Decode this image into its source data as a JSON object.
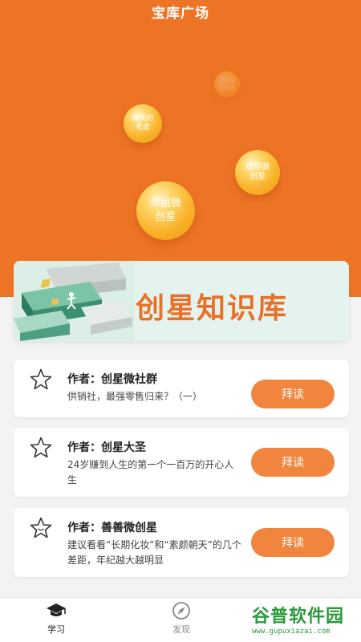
{
  "header": {
    "title": "宝库广场"
  },
  "bubbles": [
    {
      "label": "骞剑花纹创业"
    },
    {
      "label": "微笑的老虎"
    },
    {
      "label": "尋导微创星"
    },
    {
      "label": "华姐微创星"
    }
  ],
  "banner": {
    "title": "创星知识库"
  },
  "articles": [
    {
      "author": "作者：创星微社群",
      "desc": "供销社，最强零售归来？（一）",
      "button": "拜读"
    },
    {
      "author": "作者：创星大圣",
      "desc": "24岁赚到人生的第一个一百万的开心人生",
      "button": "拜读"
    },
    {
      "author": "作者：善善微创星",
      "desc": "建议看看“长期化妆”和“素颜朝天”的几个差距，年纪越大越明显",
      "button": "拜读"
    }
  ],
  "tabs": [
    {
      "label": "学习"
    },
    {
      "label": "发现"
    }
  ],
  "watermark": {
    "main": "谷普软件园",
    "sub": "www.gupuxiazai.com"
  },
  "colors": {
    "accent": "#ee7425",
    "button": "#f2853d"
  }
}
